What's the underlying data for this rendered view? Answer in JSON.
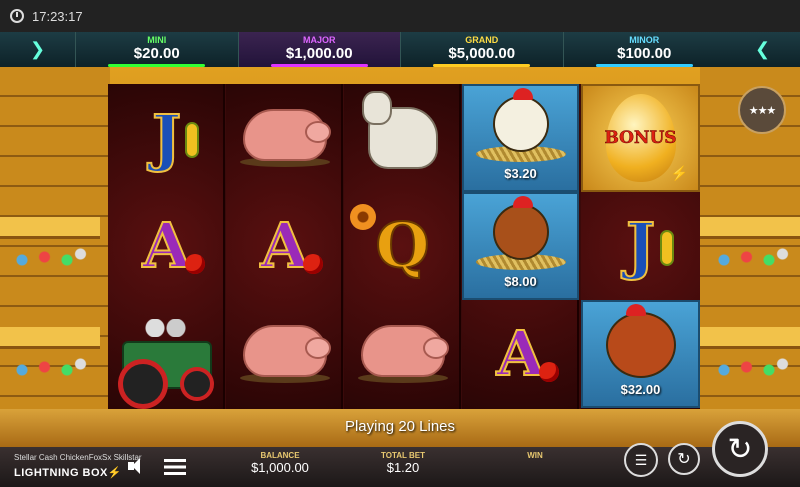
{
  "status_bar": {
    "time": "17:23:17"
  },
  "jackpots": [
    {
      "label": "MINI",
      "value": "$20.00"
    },
    {
      "label": "MAJOR",
      "value": "$1,000.00"
    },
    {
      "label": "GRAND",
      "value": "$5,000.00"
    },
    {
      "label": "MINOR",
      "value": "$100.00"
    }
  ],
  "reels": [
    [
      "J",
      "A",
      "tractor"
    ],
    [
      "pig",
      "A",
      "pig"
    ],
    [
      "goat",
      "Q",
      "pig"
    ],
    [
      "hen-$3.20",
      "hen-$8.00",
      "A"
    ],
    [
      "BONUS",
      "J",
      "rooster-$32.00"
    ]
  ],
  "symbols": {
    "letter_J": "J",
    "letter_A": "A",
    "letter_Q": "Q",
    "bonus": "BONUS",
    "prize_1": "$3.20",
    "prize_2": "$8.00",
    "prize_3": "$32.00"
  },
  "message": "Playing 20 Lines",
  "footer": {
    "game_name": "Stellar Cash ChickenFoxSx Skillstar",
    "brand": "LIGHTNING BOX",
    "balance_label": "BALANCE",
    "balance_value": "$1,000.00",
    "total_bet_label": "TOTAL BET",
    "total_bet_value": "$1.20",
    "win_label": "WIN",
    "win_value": ""
  },
  "colors": {
    "grand": "#ffdd44",
    "major": "#dd66ff",
    "mini": "#66ff66",
    "minor": "#66ddff"
  }
}
